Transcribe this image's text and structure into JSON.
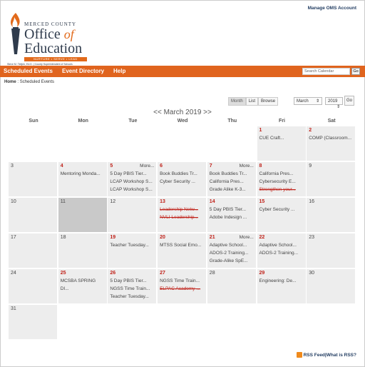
{
  "header": {
    "manage_link": "Manage OMS Account",
    "logo": {
      "line1": "MERCED COUNTY",
      "office": "Office",
      "of": "of",
      "education": "Education",
      "tagline": "NURTURE • SERVE • LEAD",
      "superintendent": "Steve M. Tietjen, Ed.D. | County Superintendent of Schools"
    }
  },
  "nav": {
    "items": [
      "Scheduled Events",
      "Event Directory",
      "Help"
    ],
    "search_placeholder": "Search Calendar",
    "go_label": "Go"
  },
  "breadcrumb": {
    "home": "Home",
    "sep": " : ",
    "current": "Scheduled Events"
  },
  "view_tabs": [
    "Month",
    "List",
    "Browse"
  ],
  "month_select": "March",
  "year_select": "2019",
  "go_label": "Go",
  "calendar_title": "<< March 2019 >>",
  "days_of_week": [
    "Sun",
    "Mon",
    "Tue",
    "Wed",
    "Thu",
    "Fri",
    "Sat"
  ],
  "weeks": [
    [
      {
        "day": ""
      },
      {
        "day": ""
      },
      {
        "day": ""
      },
      {
        "day": ""
      },
      {
        "day": ""
      },
      {
        "day": "1",
        "red": true,
        "events": [
          "CUE Craft..."
        ]
      },
      {
        "day": "2",
        "red": true,
        "events": [
          "COMP (Classroom..."
        ]
      }
    ],
    [
      {
        "day": "3"
      },
      {
        "day": "4",
        "red": true,
        "events": [
          "Mentoring Monda..."
        ]
      },
      {
        "day": "5",
        "red": true,
        "more": "More...",
        "events": [
          "5 Day PBIS Tier...",
          "LCAP Workshop S...",
          "LCAP Workshop S..."
        ]
      },
      {
        "day": "6",
        "red": true,
        "events": [
          "Book Buddies Tr...",
          "Cyber Security ..."
        ]
      },
      {
        "day": "7",
        "red": true,
        "more": "More...",
        "events": [
          "Book Buddies Tr...",
          "California Pres...",
          "Grade Alike K-3..."
        ]
      },
      {
        "day": "8",
        "red": true,
        "events": [
          "California Pres...",
          "Cybersecurity E...",
          "Strengthen your..."
        ],
        "strike": [
          2
        ]
      },
      {
        "day": "9"
      }
    ],
    [
      {
        "day": "10"
      },
      {
        "day": "11",
        "gray": true
      },
      {
        "day": "12"
      },
      {
        "day": "13",
        "red": true,
        "events": [
          "Leadership Netw...",
          "NVLI Leadership..."
        ],
        "strike": [
          0,
          1
        ]
      },
      {
        "day": "14",
        "red": true,
        "events": [
          "5 Day PBIS Tier...",
          "Adobe Indesign ..."
        ]
      },
      {
        "day": "15",
        "red": true,
        "events": [
          "Cyber Security ..."
        ]
      },
      {
        "day": "16"
      }
    ],
    [
      {
        "day": "17"
      },
      {
        "day": "18"
      },
      {
        "day": "19",
        "red": true,
        "events": [
          "Teacher Tuesday..."
        ]
      },
      {
        "day": "20",
        "red": true,
        "events": [
          "MTSS Social Emo..."
        ]
      },
      {
        "day": "21",
        "red": true,
        "more": "More...",
        "events": [
          "Adaptive School...",
          "ADOS-2 Training...",
          "Grade-Alike SpE..."
        ]
      },
      {
        "day": "22",
        "red": true,
        "events": [
          "Adaptive School...",
          "ADOS-2 Training..."
        ]
      },
      {
        "day": "23"
      }
    ],
    [
      {
        "day": "24"
      },
      {
        "day": "25",
        "red": true,
        "events": [
          "MCSBA SPRING",
          "DI..."
        ]
      },
      {
        "day": "26",
        "red": true,
        "events": [
          "5 Day PBIS Tier...",
          "NGSS Time Train...",
          "Teacher Tuesday..."
        ]
      },
      {
        "day": "27",
        "red": true,
        "events": [
          "NGSS Time Train...",
          "ELPAC Academy-..."
        ],
        "strike": [
          1
        ]
      },
      {
        "day": "28"
      },
      {
        "day": "29",
        "red": true,
        "events": [
          "Engineering: De..."
        ]
      },
      {
        "day": "30"
      }
    ],
    [
      {
        "day": "31"
      }
    ]
  ],
  "footer": {
    "rss": "RSS Feed",
    "sep": " | ",
    "what": "What is RSS?"
  },
  "colors": {
    "nav": "#e0641e",
    "accent_red": "#c0221a",
    "link": "#1f3a5f"
  }
}
